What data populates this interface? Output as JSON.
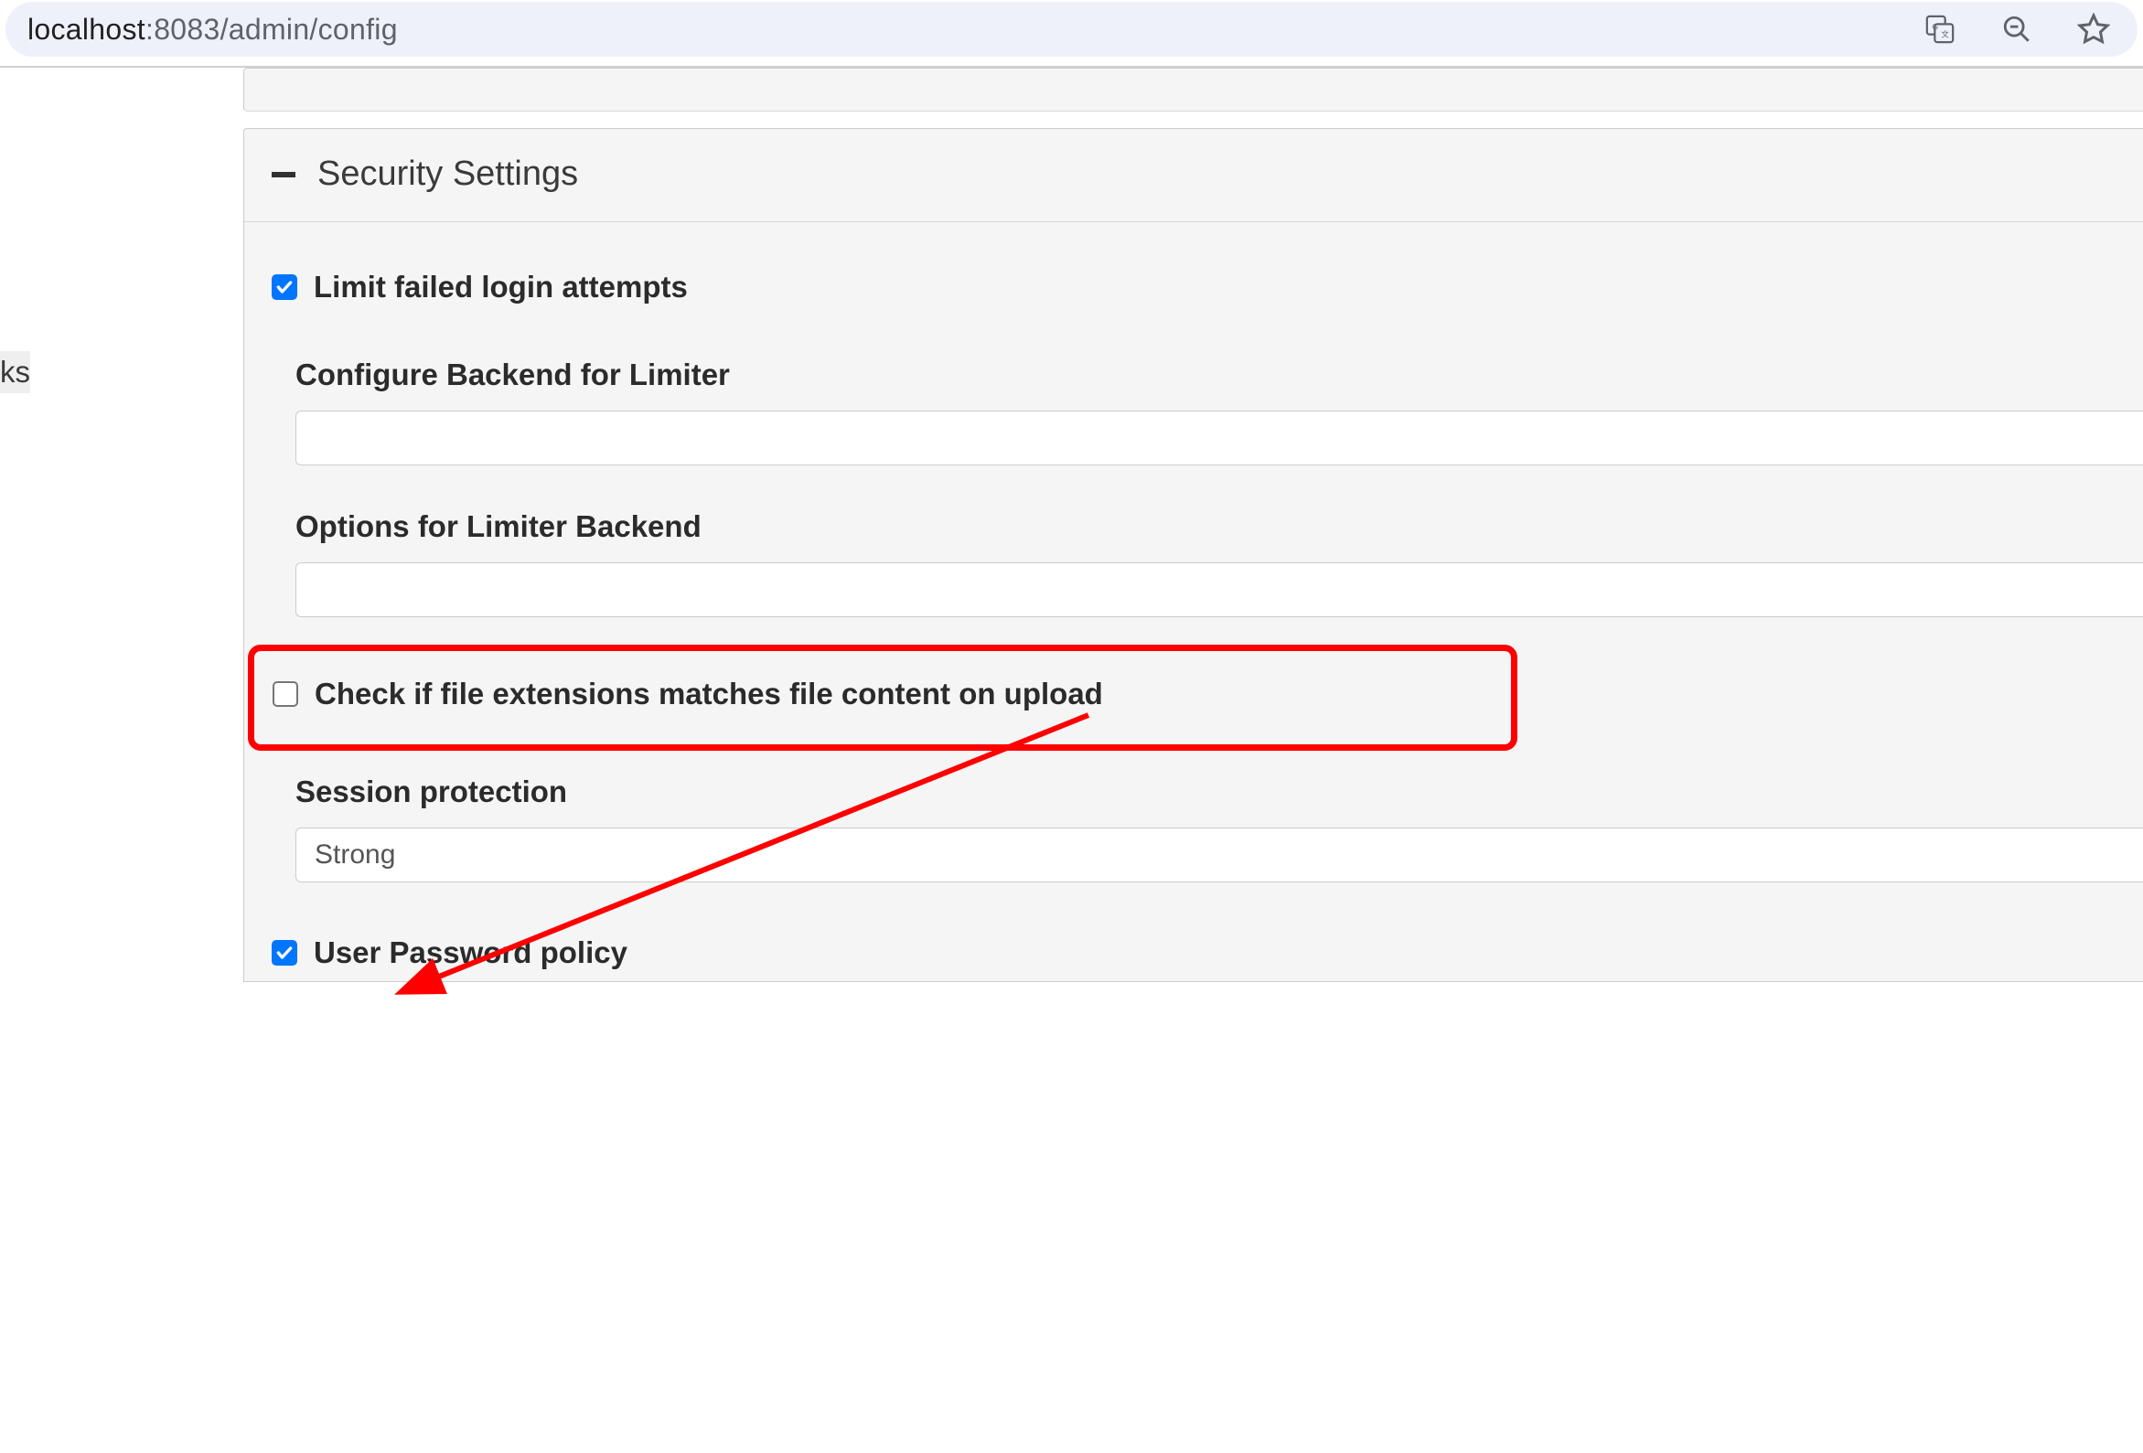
{
  "browser": {
    "url_host": "localhost",
    "url_rest": ":8083/admin/config"
  },
  "sidebar": {
    "fragment": "ks"
  },
  "panel": {
    "title": "Security Settings",
    "fields": {
      "limit_failed_login": {
        "label": "Limit failed login attempts",
        "checked": true
      },
      "backend_limiter": {
        "label": "Configure Backend for Limiter",
        "value": ""
      },
      "limiter_options": {
        "label": "Options for Limiter Backend",
        "value": ""
      },
      "check_file_ext": {
        "label": "Check if file extensions matches file content on upload",
        "checked": false
      },
      "session_protection": {
        "label": "Session protection",
        "value": "Strong"
      },
      "password_policy": {
        "label": "User Password policy",
        "checked": true
      }
    }
  }
}
